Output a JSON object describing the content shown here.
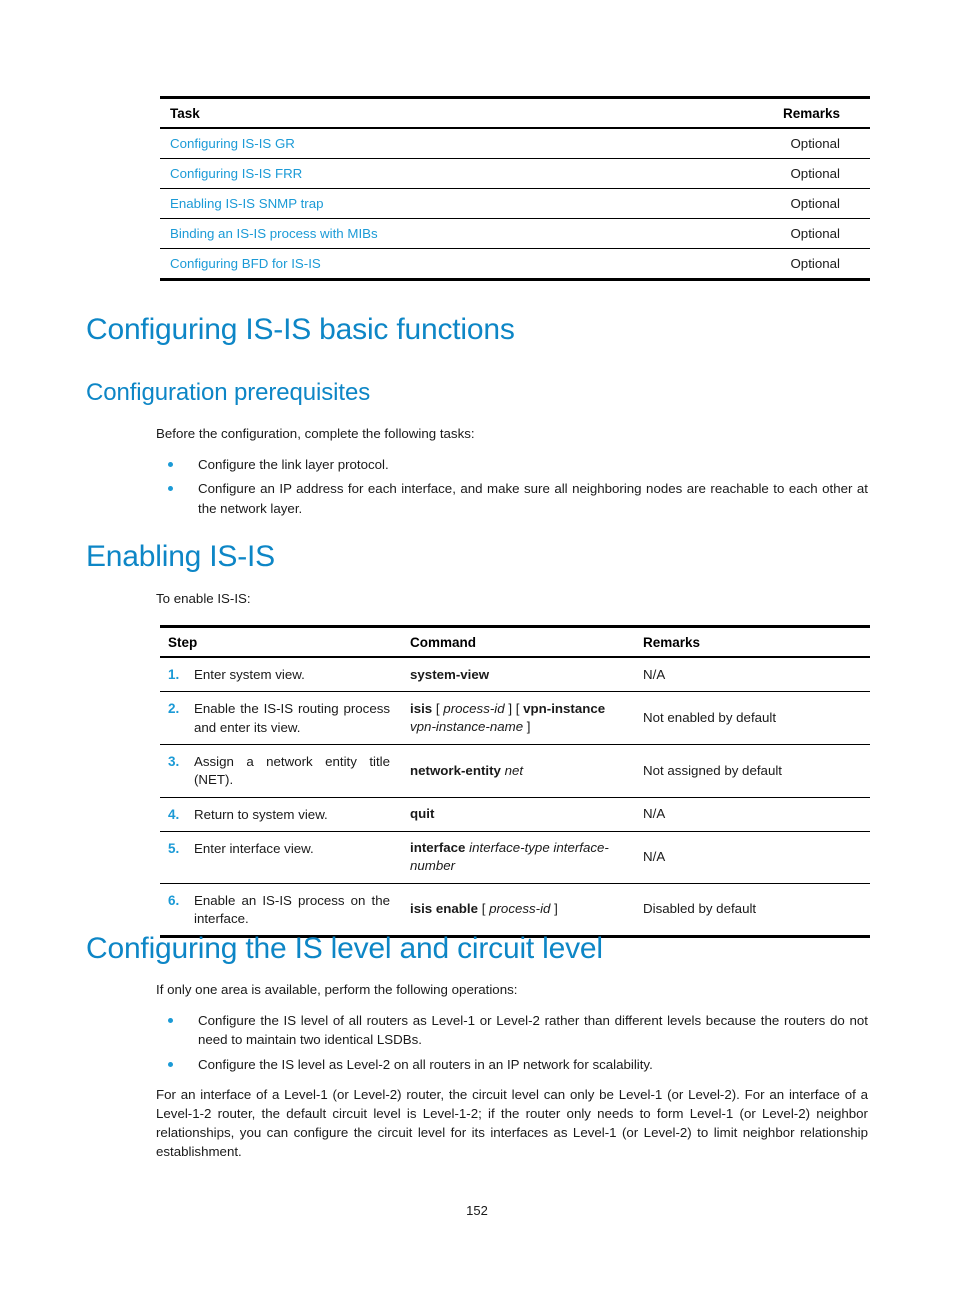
{
  "page": {
    "number": "152",
    "accent_link_color": "#1B9AD6",
    "accent_heading_color": "#0D86C6"
  },
  "task_table": {
    "headers": {
      "task": "Task",
      "remarks": "Remarks"
    },
    "rows": [
      {
        "task": "Configuring IS-IS GR",
        "remarks": "Optional"
      },
      {
        "task": "Configuring IS-IS FRR",
        "remarks": "Optional"
      },
      {
        "task": "Enabling IS-IS SNMP trap",
        "remarks": "Optional"
      },
      {
        "task": "Binding an IS-IS process with MIBs",
        "remarks": "Optional"
      },
      {
        "task": "Configuring BFD for IS-IS",
        "remarks": "Optional"
      }
    ]
  },
  "section_basic_functions": {
    "heading": "Configuring IS-IS basic functions",
    "prerequisites": {
      "heading": "Configuration prerequisites",
      "intro": "Before the configuration, complete the following tasks:",
      "bullets": [
        "Configure the link layer protocol.",
        "Configure an IP address for each interface, and make sure all neighboring nodes are reachable to each other at the network layer."
      ]
    }
  },
  "section_enabling_isis": {
    "heading": "Enabling IS-IS",
    "intro": "To enable IS-IS:",
    "table": {
      "headers": {
        "step": "Step",
        "command": "Command",
        "remarks": "Remarks"
      },
      "rows": [
        {
          "num": "1.",
          "step": "Enter system view.",
          "command_html": "<b>system-view</b>",
          "remarks": "N/A"
        },
        {
          "num": "2.",
          "step": "Enable the IS-IS routing process and enter its view.",
          "command_html": "<b>isis</b> [ <i>process-id</i> ] [ <b>vpn-instance</b> <i>vpn-instance-name</i> ]",
          "remarks": "Not enabled by default"
        },
        {
          "num": "3.",
          "step": "Assign a network entity title (NET).",
          "command_html": "<b>network-entity</b> <i>net</i>",
          "remarks": "Not assigned by default"
        },
        {
          "num": "4.",
          "step": "Return to system view.",
          "command_html": "<b>quit</b>",
          "remarks": "N/A"
        },
        {
          "num": "5.",
          "step": "Enter interface view.",
          "command_html": "<b>interface</b> <i>interface-type interface-number</i>",
          "remarks": "N/A"
        },
        {
          "num": "6.",
          "step": "Enable an IS-IS process on the interface.",
          "command_html": "<b>isis enable</b> [ <i>process-id</i> ]",
          "remarks": "Disabled by default"
        }
      ]
    }
  },
  "section_is_level": {
    "heading": "Configuring the IS level and circuit level",
    "intro": "If only one area is available, perform the following operations:",
    "bullets": [
      "Configure the IS level of all routers as Level-1 or Level-2 rather than different levels because the routers do not need to maintain two identical LSDBs.",
      "Configure the IS level as Level-2 on all routers in an IP network for scalability."
    ],
    "paragraph": "For an interface of a Level-1 (or Level-2) router, the circuit level can only be Level-1 (or Level-2). For an interface of a Level-1-2 router, the default circuit level is Level-1-2; if the router only needs to form Level-1 (or Level-2) neighbor relationships, you can configure the circuit level for its interfaces as Level-1 (or Level-2) to limit neighbor relationship establishment."
  }
}
